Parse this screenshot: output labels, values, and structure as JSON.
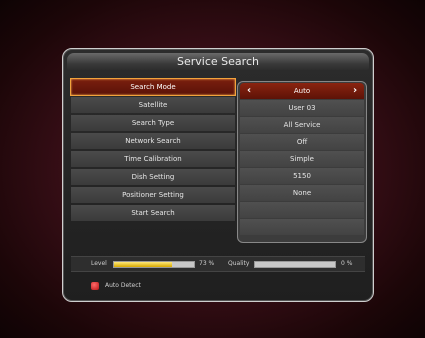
{
  "title": "Service Search",
  "menu": [
    {
      "label": "Search Mode"
    },
    {
      "label": "Satellite"
    },
    {
      "label": "Search Type"
    },
    {
      "label": "Network Search"
    },
    {
      "label": "Time Calibration"
    },
    {
      "label": "Dish Setting"
    },
    {
      "label": "Positioner Setting"
    },
    {
      "label": "Start Search"
    }
  ],
  "values": [
    {
      "value": "Auto"
    },
    {
      "value": "User 03"
    },
    {
      "value": "All Service"
    },
    {
      "value": "Off"
    },
    {
      "value": "Simple"
    },
    {
      "value": "5150"
    },
    {
      "value": "None"
    },
    {
      "value": ""
    },
    {
      "value": ""
    }
  ],
  "signal": {
    "level_label": "Level",
    "level_value": "73 %",
    "level_fraction": 0.73,
    "quality_label": "Quality",
    "quality_value": "0 %",
    "quality_fraction": 0
  },
  "status": {
    "auto_detect_label": "Auto Detect"
  },
  "colors": {
    "selected_bg": "#7a1f0e",
    "highlight_border": "#f2a33c",
    "level_fill": "#e8c21a"
  }
}
